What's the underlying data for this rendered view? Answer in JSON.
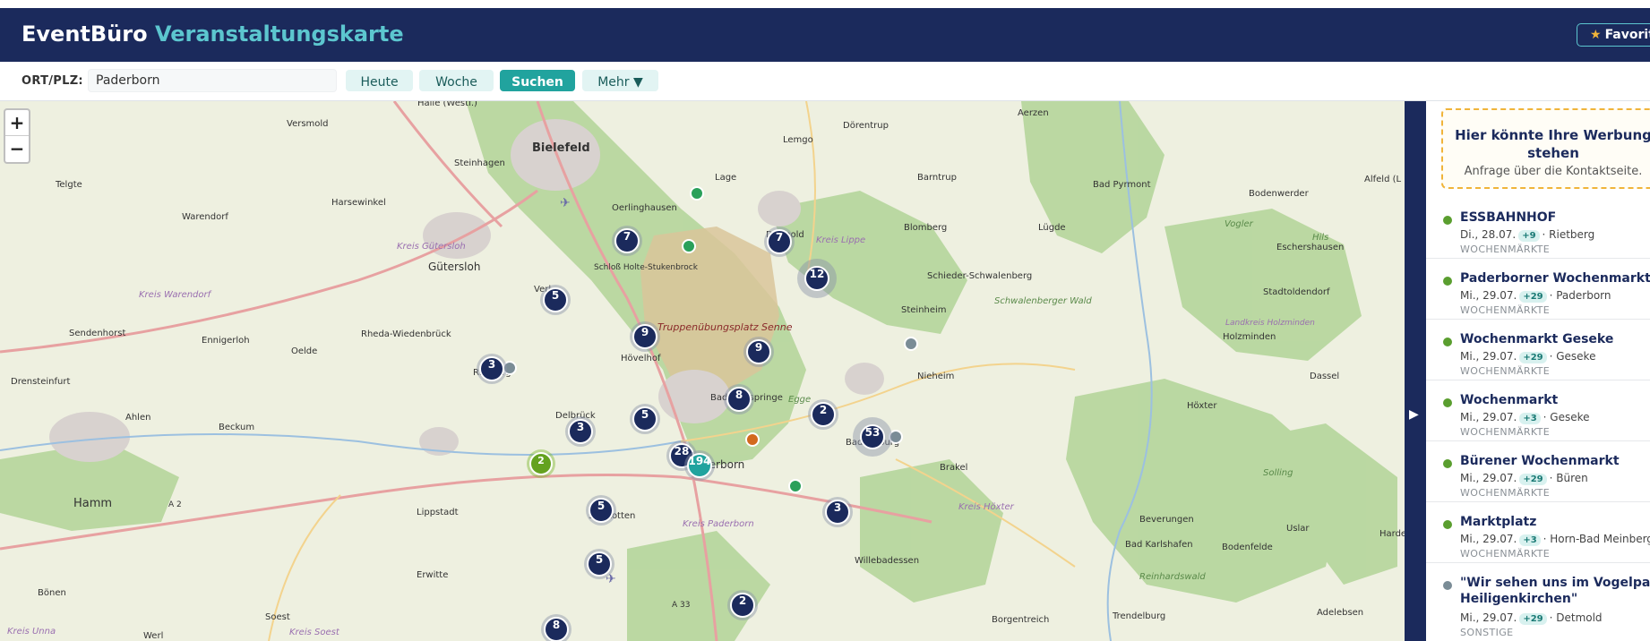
{
  "header": {
    "brand_main": "EventBüro",
    "brand_accent": "Veranstaltungskarte",
    "favorites_label": "Favorit"
  },
  "toolbar": {
    "location_label": "ORT/PLZ:",
    "location_value": "Paderborn",
    "today_label": "Heute",
    "week_label": "Woche",
    "search_label": "Suchen",
    "more_label": "Mehr ▼"
  },
  "map": {
    "zoom_in": "+",
    "zoom_out": "−",
    "places": [
      "Halle (Westf.)",
      "Versmold",
      "Bielefeld",
      "Lemgo",
      "Aerzen",
      "Dörentrup",
      "Steinhagen",
      "Lage",
      "Barntrup",
      "Bad Pyrmont",
      "Telgte",
      "Harsewinkel",
      "Oerlinghausen",
      "Warendorf",
      "Kreis Gütersloh",
      "Kreis Lippe",
      "Blomberg",
      "Lügde",
      "Bodenwerder",
      "Gütersloh",
      "Detmold",
      "Schieder-Schwalenberg",
      "Eschershausen",
      "Kreis Warendorf",
      "Schloß Holte-Stukenbrock",
      "Steinheim",
      "Schwalenberger Wald",
      "Stadtoldendorf",
      "Sendenhorst",
      "Ennigerloh",
      "Rheda-Wiedenbrück",
      "Verl",
      "Truppenübungsplatz Senne",
      "Holzminden",
      "Oelde",
      "Hövelhof",
      "Nieheim",
      "Drensteinfurt",
      "Rietberg",
      "Bad Lippspringe",
      "Egge",
      "Höxter",
      "Dassel",
      "Ahlen",
      "Beckum",
      "Delbrück",
      "Bad Driburg",
      "Brakel",
      "Solling",
      "Hamm",
      "Paderborn",
      "Kreis Paderborn",
      "Lippstadt",
      "Salzkotten",
      "Kreis Höxter",
      "Beverungen",
      "Uslar",
      "Bad Karlshafen",
      "Bodenfelde",
      "Erwitte",
      "Willebadessen",
      "Reinhardswald",
      "Bönen",
      "Soest",
      "Borgentreich",
      "Trendelburg",
      "Adelebsen",
      "Kreis Unna",
      "Werl",
      "Kreis Soest",
      "A 2",
      "A 33",
      "Landkreis Holzminden",
      "Vogler",
      "Hils",
      "Alfeld (L",
      "Harde"
    ],
    "clusters": [
      "7",
      "7",
      "12",
      "5",
      "9",
      "3",
      "9",
      "8",
      "2",
      "53",
      "3",
      "5",
      "28",
      "194",
      "5",
      "3",
      "5",
      "2",
      "2",
      "8"
    ]
  },
  "sidebar": {
    "ad_title": "Hier könnte Ihre Werbung stehen",
    "ad_subtitle": "Anfrage über die Kontaktseite.",
    "events": [
      {
        "title": "ESSBAHNHOF",
        "date": "Di., 28.07.",
        "badge": "+9",
        "place": "· Rietberg",
        "category": "WOCHENMÄRKTE",
        "dot": "#5a9e2f"
      },
      {
        "title": "Paderborner Wochenmarkt",
        "date": "Mi., 29.07.",
        "badge": "+29",
        "place": "· Paderborn",
        "category": "WOCHENMÄRKTE",
        "dot": "#5a9e2f"
      },
      {
        "title": "Wochenmarkt Geseke",
        "date": "Mi., 29.07.",
        "badge": "+29",
        "place": "· Geseke",
        "category": "WOCHENMÄRKTE",
        "dot": "#5a9e2f"
      },
      {
        "title": "Wochenmarkt",
        "date": "Mi., 29.07.",
        "badge": "+3",
        "place": "· Geseke",
        "category": "WOCHENMÄRKTE",
        "dot": "#5a9e2f"
      },
      {
        "title": "Bürener Wochenmarkt",
        "date": "Mi., 29.07.",
        "badge": "+29",
        "place": "· Büren",
        "category": "WOCHENMÄRKTE",
        "dot": "#5a9e2f"
      },
      {
        "title": "Marktplatz",
        "date": "Mi., 29.07.",
        "badge": "+3",
        "place": "· Horn-Bad Meinberg",
        "category": "WOCHENMÄRKTE",
        "dot": "#5a9e2f"
      },
      {
        "title": "\"Wir sehen uns im Vogelpark",
        "title2": "Heiligenkirchen\"",
        "date": "Mi., 29.07.",
        "badge": "+29",
        "place": "· Detmold",
        "category": "SONSTIGE",
        "dot": "#7a8c96"
      }
    ]
  },
  "colors": {
    "header_bg": "#1b2a5c",
    "accent": "#5cc6cf",
    "primary_button": "#21a39e",
    "cluster": "#1b2a5c",
    "cluster_selected": "#21a39e",
    "marker_green": "#2aa05a",
    "marker_orange": "#d2691e",
    "marker_gray": "#7a8c96"
  }
}
